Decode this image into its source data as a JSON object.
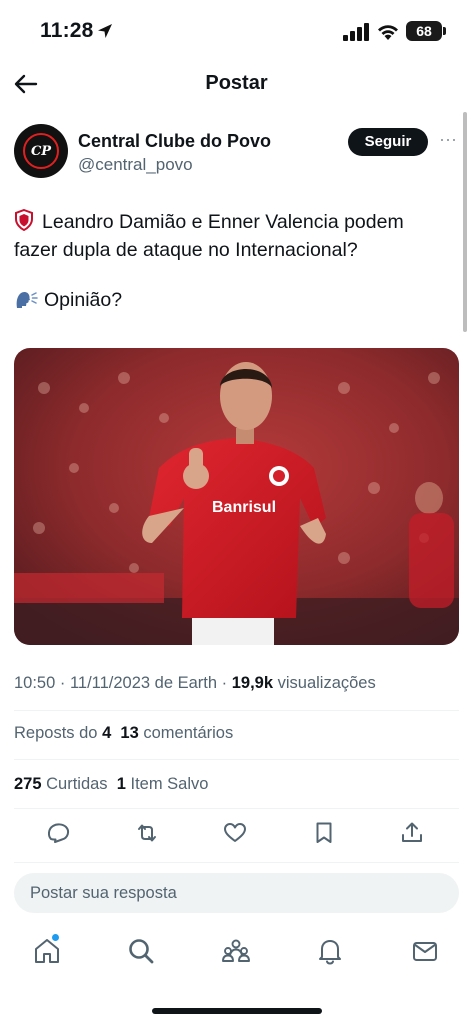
{
  "status_bar": {
    "time": "11:28",
    "battery": "68",
    "icons": [
      "location-arrow-icon",
      "signal-icon",
      "wifi-icon",
      "battery-icon"
    ]
  },
  "header": {
    "title": "Postar",
    "back_icon": "back-arrow-icon"
  },
  "author": {
    "name": "Central Clube do Povo",
    "handle": "@central_povo",
    "avatar_text": "CP",
    "follow_label": "Seguir",
    "more_label": "···"
  },
  "post": {
    "line1": "Leandro Damião e Enner Valencia podem",
    "line2": "fazer dupla de ataque no Internacional?",
    "line3": "Opinião?",
    "image_jersey_text": "Banrisul"
  },
  "meta": {
    "time_date": "10:50 · 11/11/2023 de Earth · ",
    "views_count": "19,9k",
    "views_label": " visualizações"
  },
  "stats": {
    "reposts_label": "Reposts do ",
    "reposts_count": "4",
    "comments_count": "13",
    "comments_label": " comentários",
    "likes_count": "275",
    "likes_label": " Curtidas",
    "saved_count": "1",
    "saved_label": " Item Salvo"
  },
  "actions": [
    "reply-icon",
    "repost-icon",
    "like-icon",
    "bookmark-icon",
    "share-icon"
  ],
  "reply": {
    "placeholder": "Postar sua resposta"
  },
  "tabbar": [
    "home-icon",
    "search-icon",
    "communities-icon",
    "notifications-icon",
    "messages-icon"
  ],
  "colors": {
    "text": "#0f1419",
    "muted": "#536471",
    "accent": "#1d9bf0",
    "jersey_red": "#d3202a"
  }
}
